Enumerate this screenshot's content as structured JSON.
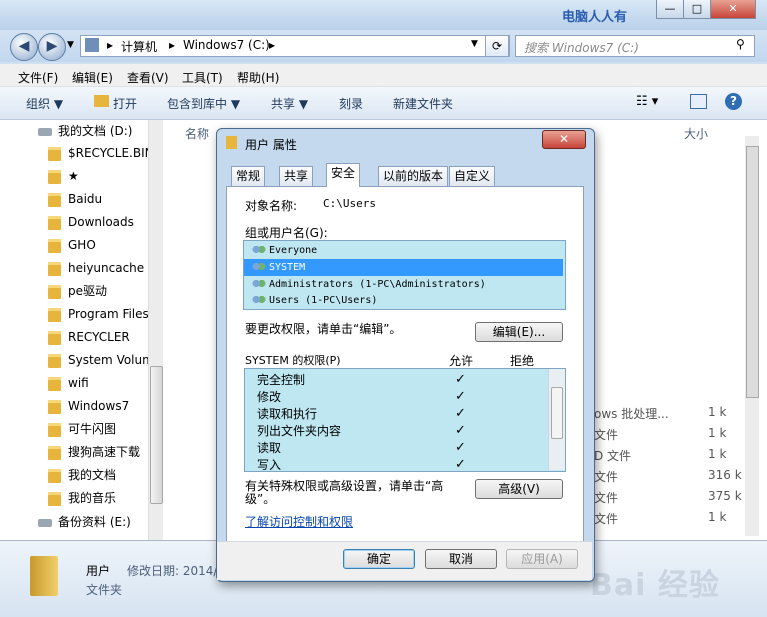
{
  "window": {
    "watermark": "电脑人人有",
    "controls": [
      "—",
      "□",
      "✕"
    ]
  },
  "address": {
    "crumbs": [
      "计算机",
      "Windows7 (C:)"
    ],
    "search_placeholder": "搜索 Windows7 (C:)"
  },
  "menu": [
    "文件(F)",
    "编辑(E)",
    "查看(V)",
    "工具(T)",
    "帮助(H)"
  ],
  "toolbar": [
    "组织 ▼",
    "打开",
    "包含到库中 ▼",
    "共享 ▼",
    "刻录",
    "新建文件夹"
  ],
  "nav": {
    "root": "我的文档 (D:)",
    "items": [
      "$RECYCLE.BIN",
      "★",
      "Baidu",
      "Downloads",
      "GHO",
      "heiyuncache",
      "pe驱动",
      "Program Files",
      "RECYCLER",
      "System Volum",
      "wifi",
      "Windows7",
      "可牛闪图",
      "搜狗高速下载",
      "我的文档",
      "我的音乐"
    ],
    "drive2": "备份资料 (E:)"
  },
  "files": {
    "col_name": "名称",
    "col_size": "大小",
    "right_types": [
      "ows 批处理...",
      "文件",
      "D 文件",
      "文件",
      "文件",
      "文件"
    ],
    "right_sizes": [
      "1 k",
      "1 k",
      "1 k",
      "316 k",
      "375 k",
      "1 k"
    ]
  },
  "details": {
    "name": "用户",
    "modified_label": "修改日期: 2014/",
    "type": "文件夹"
  },
  "dialog": {
    "title": "用户 属性",
    "tabs": [
      "常规",
      "共享",
      "安全",
      "以前的版本",
      "自定义"
    ],
    "object_label": "对象名称:",
    "object_value": "C:\\Users",
    "group_label": "组或用户名(G):",
    "users": [
      "Everyone",
      "SYSTEM",
      "Administrators (1-PC\\Administrators)",
      "Users (1-PC\\Users)"
    ],
    "edit_hint": "要更改权限，请单击“编辑”。",
    "edit_button": "编辑(E)...",
    "perm_header": "SYSTEM 的权限(P)",
    "allow": "允许",
    "deny": "拒绝",
    "permissions": [
      "完全控制",
      "修改",
      "读取和执行",
      "列出文件夹内容",
      "读取",
      "写入"
    ],
    "adv_hint_line1": "有关特殊权限或高级设置，请单击“高",
    "adv_hint_line2": "级”。",
    "adv_button": "高级(V)",
    "link": "了解访问控制和权限",
    "ok": "确定",
    "cancel": "取消",
    "apply": "应用(A)"
  },
  "watermark_brand": "Bai 经验"
}
